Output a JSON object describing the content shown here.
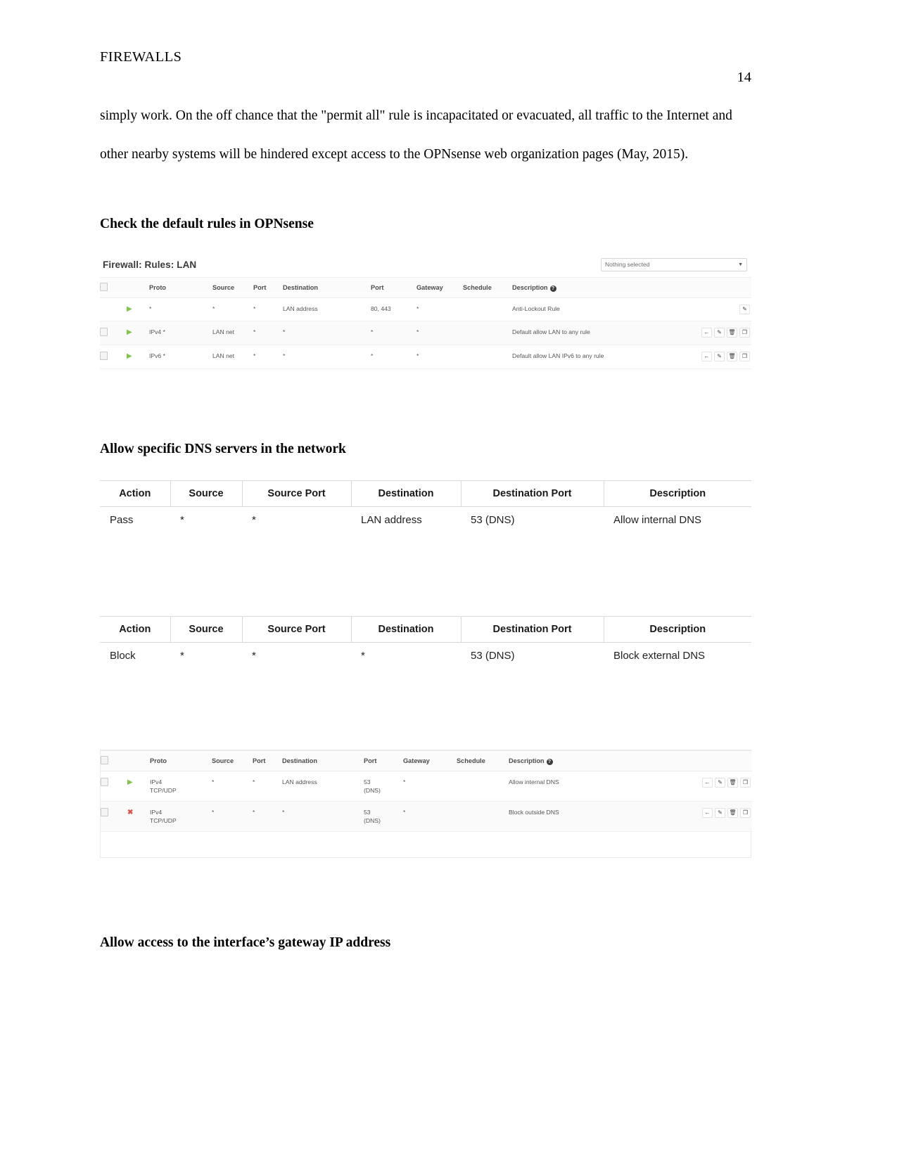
{
  "document": {
    "running_head": "FIREWALLS",
    "page_number": "14",
    "paragraph": "simply work. On the off chance that the \"permit all\" rule is incapacitated or evacuated, all traffic to the Internet and other nearby systems will be hindered except access to the OPNsense web organization pages (May, 2015).",
    "heading_check_rules": "Check the default rules in OPNsense",
    "heading_dns": "Allow specific DNS servers in the network",
    "heading_gateway": "Allow access to the interface’s gateway IP address"
  },
  "opnsense_lan": {
    "title": "Firewall: Rules: LAN",
    "select_value": "Nothing selected",
    "caret_icon": "chevron-down-icon",
    "columns": [
      "",
      "",
      "Proto",
      "Source",
      "Port",
      "Destination",
      "Port",
      "Gateway",
      "Schedule",
      "Description",
      ""
    ],
    "description_help_icon": "help-circle-icon",
    "rows": [
      {
        "checkbox": false,
        "show_checkbox": false,
        "action_icon": "pass-arrow-icon",
        "action_type": "pass",
        "proto": "*",
        "source": "*",
        "port": "*",
        "destination": "LAN address",
        "dest_port": "80, 443",
        "gateway": "*",
        "schedule": "",
        "description": "Anti-Lockout Rule",
        "actions": [
          "edit-pencil-icon"
        ]
      },
      {
        "checkbox": false,
        "show_checkbox": true,
        "action_icon": "pass-arrow-icon",
        "action_type": "pass",
        "proto": "IPv4 *",
        "source": "LAN net",
        "port": "*",
        "destination": "*",
        "dest_port": "*",
        "gateway": "*",
        "schedule": "",
        "description": "Default allow LAN to any rule",
        "actions": [
          "move-left-arrow-icon",
          "edit-pencil-icon",
          "delete-trash-icon",
          "clone-copy-icon"
        ]
      },
      {
        "checkbox": false,
        "show_checkbox": true,
        "action_icon": "pass-arrow-icon",
        "action_type": "pass",
        "proto": "IPv6 *",
        "source": "LAN net",
        "port": "*",
        "destination": "*",
        "dest_port": "*",
        "gateway": "*",
        "schedule": "",
        "description": "Default allow LAN IPv6 to any rule",
        "actions": [
          "move-left-arrow-icon",
          "edit-pencil-icon",
          "delete-trash-icon",
          "clone-copy-icon"
        ]
      }
    ]
  },
  "dns_rule_tables": [
    {
      "name": "pass-rule-table",
      "columns": [
        "Action",
        "Source",
        "Source Port",
        "Destination",
        "Destination Port",
        "Description"
      ],
      "row": [
        "Pass",
        "*",
        "*",
        "LAN address",
        "53 (DNS)",
        "Allow internal DNS"
      ]
    },
    {
      "name": "block-rule-table",
      "columns": [
        "Action",
        "Source",
        "Source Port",
        "Destination",
        "Destination Port",
        "Description"
      ],
      "row": [
        "Block",
        "*",
        "*",
        "*",
        "53 (DNS)",
        "Block external DNS"
      ]
    }
  ],
  "opnsense_dns": {
    "columns": [
      "",
      "",
      "Proto",
      "Source",
      "Port",
      "Destination",
      "Port",
      "Gateway",
      "Schedule",
      "Description",
      ""
    ],
    "description_help_icon": "help-circle-icon",
    "rows": [
      {
        "show_checkbox": true,
        "action_icon": "pass-arrow-icon",
        "action_type": "pass",
        "proto_line1": "IPv4",
        "proto_line2": "TCP/UDP",
        "source": "*",
        "port": "*",
        "destination": "LAN address",
        "dest_port_line1": "53",
        "dest_port_line2": "(DNS)",
        "gateway": "*",
        "schedule": "",
        "description": "Allow internal DNS",
        "actions": [
          "move-left-arrow-icon",
          "edit-pencil-icon",
          "delete-trash-icon",
          "clone-copy-icon"
        ]
      },
      {
        "show_checkbox": true,
        "action_icon": "block-x-icon",
        "action_type": "block",
        "proto_line1": "IPv4",
        "proto_line2": "TCP/UDP",
        "source": "*",
        "port": "*",
        "destination": "*",
        "dest_port_line1": "53",
        "dest_port_line2": "(DNS)",
        "gateway": "*",
        "schedule": "",
        "description": "Block outside DNS",
        "actions": [
          "move-left-arrow-icon",
          "edit-pencil-icon",
          "delete-trash-icon",
          "clone-copy-icon"
        ]
      }
    ]
  },
  "colors": {
    "pass_green": "#83c24c",
    "block_red": "#d9534f",
    "border_gray": "#e9eaea"
  }
}
